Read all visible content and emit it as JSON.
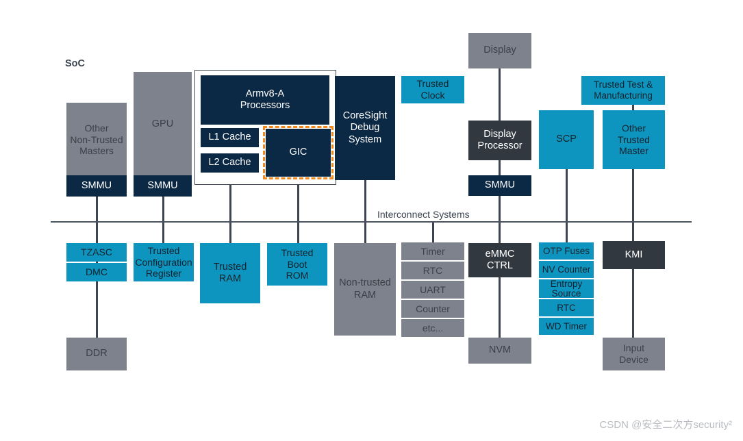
{
  "diagram": {
    "soc_label": "SoC",
    "interconnect_label": "Interconnect Systems",
    "watermark": "CSDN @安全二次方security²",
    "colors": {
      "gray": "#7e828d",
      "navy": "#0b2844",
      "cyan": "#0d95bf",
      "charcoal": "#323840",
      "line": "#3b4450",
      "gic_highlight": "#f08a1e"
    }
  },
  "blocks": {
    "other_non_trusted_masters": "Other\nNon-Trusted\nMasters",
    "smmu_masters": "SMMU",
    "gpu": "GPU",
    "smmu_gpu": "SMMU",
    "armv8a_processors": "Armv8-A\nProcessors",
    "l1_cache": "L1 Cache",
    "l2_cache": "L2 Cache",
    "gic": "GIC",
    "coresight": "CoreSight\nDebug\nSystem",
    "trusted_clock": "Trusted\nClock",
    "display": "Display",
    "display_processor": "Display\nProcessor",
    "smmu_display": "SMMU",
    "scp": "SCP",
    "trusted_test_manufacturing": "Trusted Test &\nManufacturing",
    "other_trusted_master": "Other\nTrusted\nMaster",
    "tzasc": "TZASC",
    "dmc": "DMC",
    "ddr": "DDR",
    "trusted_configuration_register": "Trusted\nConfiguration\nRegister",
    "trusted_ram": "Trusted\nRAM",
    "trusted_boot_rom": "Trusted\nBoot\nROM",
    "non_trusted_ram": "Non-trusted\nRAM",
    "emmc_ctrl": "eMMC\nCTRL",
    "nvm": "NVM",
    "kmi": "KMI",
    "input_device": "Input\nDevice"
  },
  "peripheral_stack": {
    "items": [
      "Timer",
      "RTC",
      "UART",
      "Counter",
      "etc..."
    ]
  },
  "trusted_stack": {
    "items": [
      "OTP Fuses",
      "NV Counter",
      "Entropy\nSource",
      "RTC",
      "WD Timer"
    ]
  }
}
